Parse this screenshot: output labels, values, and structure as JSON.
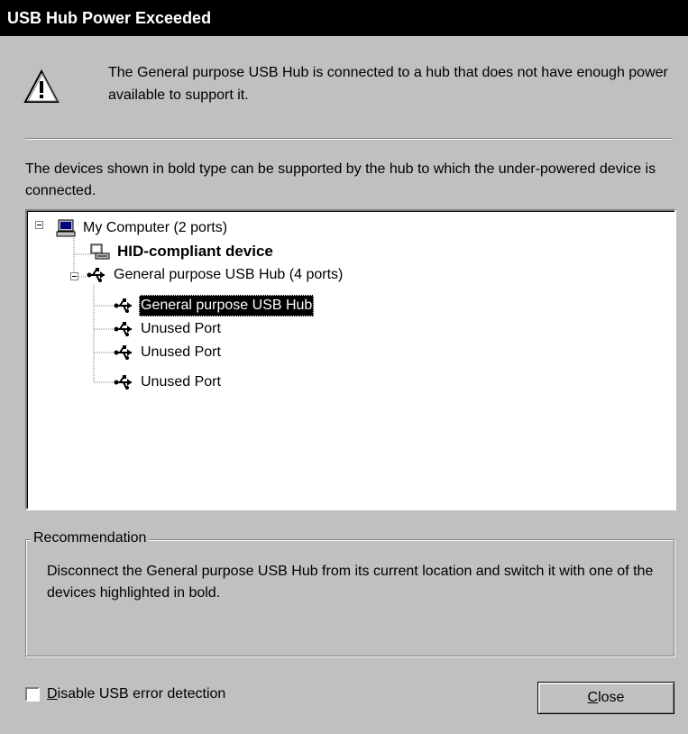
{
  "window": {
    "title": "USB Hub Power Exceeded"
  },
  "message": "The General purpose USB Hub is connected to a hub that does not have enough power available to support it.",
  "info": "The devices shown in bold type can be supported by the hub to which the under-powered device is connected.",
  "tree": {
    "root": {
      "label": "My Computer (2 ports)",
      "icon": "computer-icon",
      "expanded": true
    },
    "hid": {
      "label": "HID-compliant device",
      "icon": "hid-device-icon",
      "bold": true
    },
    "hub": {
      "label": "General purpose USB Hub (4 ports)",
      "icon": "usb-icon",
      "expanded": true
    },
    "children": [
      {
        "label": "General purpose USB Hub",
        "icon": "usb-icon",
        "selected": true
      },
      {
        "label": "Unused Port",
        "icon": "usb-icon"
      },
      {
        "label": "Unused Port",
        "icon": "usb-icon"
      },
      {
        "label": "Unused Port",
        "icon": "usb-icon"
      }
    ]
  },
  "recommendation": {
    "title": "Recommendation",
    "text": "Disconnect the General purpose USB Hub from its current location and switch it with one of the devices highlighted in bold."
  },
  "checkbox": {
    "label_hotkey": "D",
    "label_rest": "isable USB error detection",
    "checked": false
  },
  "close_button": {
    "hotkey": "C",
    "rest": "lose"
  },
  "colors": {
    "titlebar": "#000000",
    "face": "#c0c0c0",
    "selection": "#000000"
  }
}
